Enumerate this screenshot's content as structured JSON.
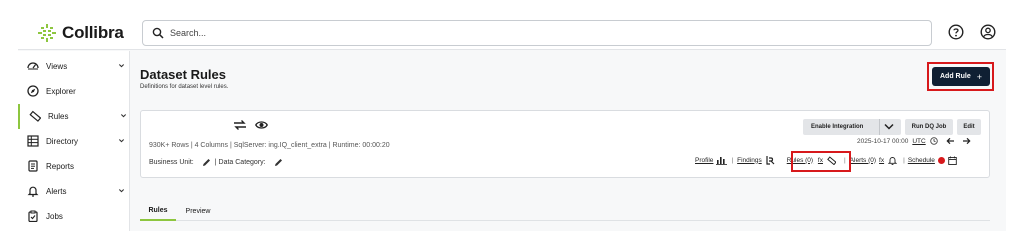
{
  "brand": {
    "name": "Collibra",
    "accent": "#8dc63f"
  },
  "search": {
    "placeholder": "Search..."
  },
  "top_icons": [
    "help-icon",
    "user-account-icon"
  ],
  "sidebar": {
    "items": [
      {
        "label": "Views",
        "icon": "views-icon",
        "has_chevron": true
      },
      {
        "label": "Explorer",
        "icon": "compass-icon",
        "has_chevron": false
      },
      {
        "label": "Rules",
        "icon": "ruler-icon",
        "has_chevron": true,
        "active": true
      },
      {
        "label": "Directory",
        "icon": "directory-icon",
        "has_chevron": true
      },
      {
        "label": "Reports",
        "icon": "report-icon",
        "has_chevron": false
      },
      {
        "label": "Alerts",
        "icon": "bell-icon",
        "has_chevron": true
      },
      {
        "label": "Jobs",
        "icon": "clipboard-icon",
        "has_chevron": false
      }
    ]
  },
  "page": {
    "title": "Dataset Rules",
    "subtitle": "Definitions for dataset level rules.",
    "add_rule_label": "Add Rule",
    "add_rule_plus": "+"
  },
  "dataset_card": {
    "meta": "930K+ Rows | 4 Columns | SqlServer: ing.IQ_client_extra | Runtime: 00:00:20",
    "business_unit_label": "Business Unit:",
    "data_category_label": "| Data Category:",
    "buttons": {
      "enable_integration": "Enable Integration",
      "run_dq_job": "Run DQ Job",
      "edit": "Edit"
    },
    "date": "2025-10-17 00:00",
    "timezone": "UTC",
    "links": {
      "profile": "Profile",
      "findings": "Findings",
      "rules": "Rules (0)",
      "rules_fx": "fx",
      "alerts": "Alerts (0)",
      "alerts_fx": "fx",
      "schedule": "Schedule",
      "sep": "|"
    },
    "colors": {
      "schedule_dot": "#d7191c",
      "highlight_box": "#d7191c"
    }
  },
  "tabs": [
    {
      "label": "Rules",
      "active": true
    },
    {
      "label": "Preview",
      "active": false
    }
  ]
}
